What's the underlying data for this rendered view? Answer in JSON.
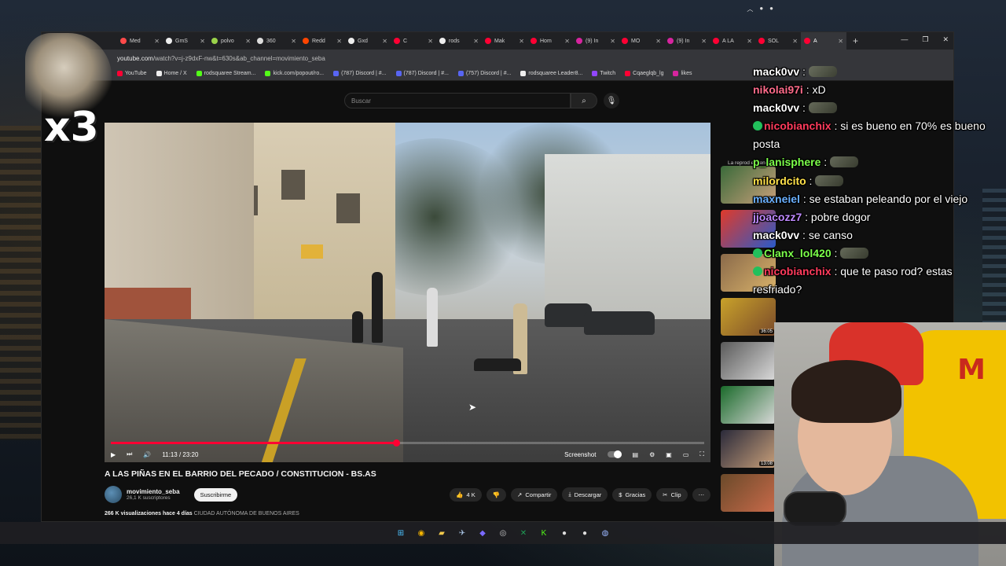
{
  "browser": {
    "tabs": [
      {
        "label": "Med",
        "color": "#ff4a4a"
      },
      {
        "label": "GmS",
        "color": "#eeeeee"
      },
      {
        "label": "polvo",
        "color": "#9ad24a"
      },
      {
        "label": "360",
        "color": "#dddddd"
      },
      {
        "label": "Redd",
        "color": "#ff4500"
      },
      {
        "label": "Gxd",
        "color": "#eeeeee"
      },
      {
        "label": "C",
        "color": "#ff0033"
      },
      {
        "label": "rods",
        "color": "#eeeeee"
      },
      {
        "label": "Mak",
        "color": "#ff0033"
      },
      {
        "label": "Hom",
        "color": "#ff0033"
      },
      {
        "label": "(9) In",
        "color": "#d6249f"
      },
      {
        "label": "MO",
        "color": "#ff0033"
      },
      {
        "label": "(9) In",
        "color": "#d6249f"
      },
      {
        "label": "A LA",
        "color": "#ff0033"
      },
      {
        "label": "SOL",
        "color": "#ff0033"
      },
      {
        "label": "A",
        "color": "#ff0033"
      }
    ],
    "url_host": "youtube.com",
    "url_path": "/watch?v=j-z9dxF-nw&t=630s&ab_channel=movimiento_seba",
    "bookmarks": [
      {
        "label": "YouTube",
        "color": "#ff0033"
      },
      {
        "label": "Home / X",
        "color": "#eeeeee"
      },
      {
        "label": "rodsquaree Stream...",
        "color": "#53fc18"
      },
      {
        "label": "kick.com/popout/ro...",
        "color": "#53fc18"
      },
      {
        "label": "(787) Discord | #...",
        "color": "#5865f2"
      },
      {
        "label": "(787) Discord | #...",
        "color": "#5865f2"
      },
      {
        "label": "(757) Discord | #...",
        "color": "#5865f2"
      },
      {
        "label": "rodsquaree Leader8...",
        "color": "#eeeeee"
      },
      {
        "label": "Twitch",
        "color": "#9146ff"
      },
      {
        "label": "Cqaeglqb_lg",
        "color": "#ff0033"
      },
      {
        "label": "likes",
        "color": "#d6249f"
      }
    ]
  },
  "youtube": {
    "search_placeholder": "Buscar",
    "time": "11:13 / 23:20",
    "progress": 0.481,
    "screenshot_label": "Screenshot",
    "title": "A LAS PIÑAS EN EL BARRIO DEL PECADO / CONSTITUCION - BS.AS",
    "channel": "movimiento_seba",
    "subs": "26,1 K suscriptores",
    "subscribe": "Suscribirme",
    "likes": "4 K",
    "share": "Compartir",
    "download": "Descargar",
    "thanks": "Gracias",
    "clip": "Clip",
    "views": "266 K visualizaciones",
    "ago": "hace 4 días",
    "location": "CIUDAD AUTÓNOMA DE BUENOS AIRES",
    "upnext": "La reprod estreno."
  },
  "related": [
    {
      "duration": "",
      "colors": [
        "#3a6a3a",
        "#c9a07a"
      ]
    },
    {
      "duration": "",
      "colors": [
        "#e03a2a",
        "#2a5ac9"
      ]
    },
    {
      "duration": "",
      "colors": [
        "#8a6a4a",
        "#d9b26a"
      ]
    },
    {
      "duration": "36:05",
      "colors": [
        "#c9a22a",
        "#7a4a2a"
      ]
    },
    {
      "duration": "",
      "colors": [
        "#5a5a5a",
        "#d9d9d9"
      ]
    },
    {
      "duration": "",
      "colors": [
        "#1a6a2a",
        "#d9d9d9"
      ]
    },
    {
      "duration": "13:08",
      "colors": [
        "#2a2a3a",
        "#c9a07a"
      ]
    },
    {
      "duration": "",
      "colors": [
        "#6a4a2a",
        "#c96a4a"
      ]
    }
  ],
  "chat": [
    {
      "user": "mack0vv",
      "color": "#ffffff",
      "badge": false,
      "text": "",
      "emote": true
    },
    {
      "user": "nikolai97i",
      "color": "#ff6b8a",
      "badge": false,
      "text": "xD",
      "emote": false
    },
    {
      "user": "mack0vv",
      "color": "#ffffff",
      "badge": false,
      "text": "",
      "emote": true
    },
    {
      "user": "nicobianchix",
      "color": "#ff3b5c",
      "badge": true,
      "text": "si es bueno en 70% es bueno posta",
      "emote": false
    },
    {
      "user": "p_lanisphere",
      "color": "#7cff4a",
      "badge": false,
      "text": "",
      "emote": true
    },
    {
      "user": "milordcito",
      "color": "#ffe14a",
      "badge": false,
      "text": "",
      "emote": true
    },
    {
      "user": "maxneiel",
      "color": "#6ab0ff",
      "badge": false,
      "text": "se estaban peleando por el viejo",
      "emote": false
    },
    {
      "user": "jjoacozz7",
      "color": "#c08aff",
      "badge": false,
      "text": "pobre dogor",
      "emote": false
    },
    {
      "user": "mack0vv",
      "color": "#ffffff",
      "badge": false,
      "text": "se canso",
      "emote": false
    },
    {
      "user": "Clanx_lol420",
      "color": "#7cff4a",
      "badge": true,
      "text": "",
      "emote": true
    },
    {
      "user": "nicobianchix",
      "color": "#ff3b5c",
      "badge": true,
      "text": "que te paso rod? estas resfriado?",
      "emote": false
    }
  ],
  "overlay": {
    "multiplier": "x3"
  },
  "taskbar": [
    {
      "name": "windows-start-icon",
      "glyph": "⊞",
      "color": "#4cc2ff"
    },
    {
      "name": "chrome-icon",
      "glyph": "◉",
      "color": "#f4b400"
    },
    {
      "name": "file-explorer-icon",
      "glyph": "▰",
      "color": "#f2c94c"
    },
    {
      "name": "steam-icon",
      "glyph": "✈",
      "color": "#a9c4e4"
    },
    {
      "name": "app-icon",
      "glyph": "◆",
      "color": "#7a6aff"
    },
    {
      "name": "obs-icon",
      "glyph": "◎",
      "color": "#cccccc"
    },
    {
      "name": "excel-icon",
      "glyph": "✕",
      "color": "#1f9d55"
    },
    {
      "name": "kick-icon",
      "glyph": "K",
      "color": "#53fc18"
    },
    {
      "name": "app-icon",
      "glyph": "●",
      "color": "#dddddd"
    },
    {
      "name": "app-icon",
      "glyph": "●",
      "color": "#dddddd"
    },
    {
      "name": "app-icon",
      "glyph": "◍",
      "color": "#9ab6ff"
    }
  ]
}
